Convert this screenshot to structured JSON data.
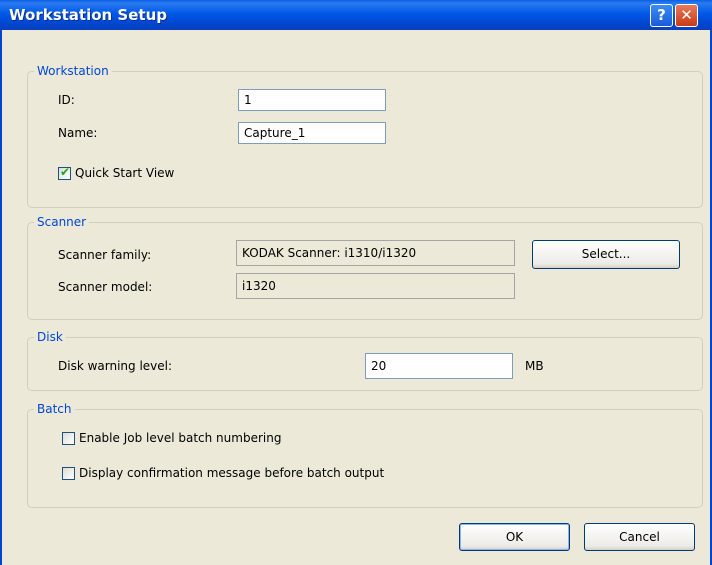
{
  "window": {
    "title": "Workstation Setup",
    "help_glyph": "?",
    "close_glyph": "✕"
  },
  "workstation": {
    "legend": "Workstation",
    "id_label": "ID:",
    "id_value": "1",
    "name_label": "Name:",
    "name_value": "Capture_1",
    "quick_start_label": "Quick Start View",
    "quick_start_checked": true
  },
  "scanner": {
    "legend": "Scanner",
    "family_label": "Scanner family:",
    "family_value": "KODAK Scanner: i1310/i1320",
    "select_label": "Select...",
    "model_label": "Scanner model:",
    "model_value": "i1320"
  },
  "disk": {
    "legend": "Disk",
    "warning_label": "Disk warning level:",
    "warning_value": "20",
    "unit": "MB"
  },
  "batch": {
    "legend": "Batch",
    "job_numbering_label": "Enable Job level batch numbering",
    "job_numbering_checked": false,
    "confirm_label": "Display confirmation message before batch output",
    "confirm_checked": false
  },
  "buttons": {
    "ok": "OK",
    "cancel": "Cancel"
  },
  "colors": {
    "titlebar": "#0058E6",
    "legend_text": "#0046D5",
    "dialog_bg": "#ECE9D8"
  }
}
